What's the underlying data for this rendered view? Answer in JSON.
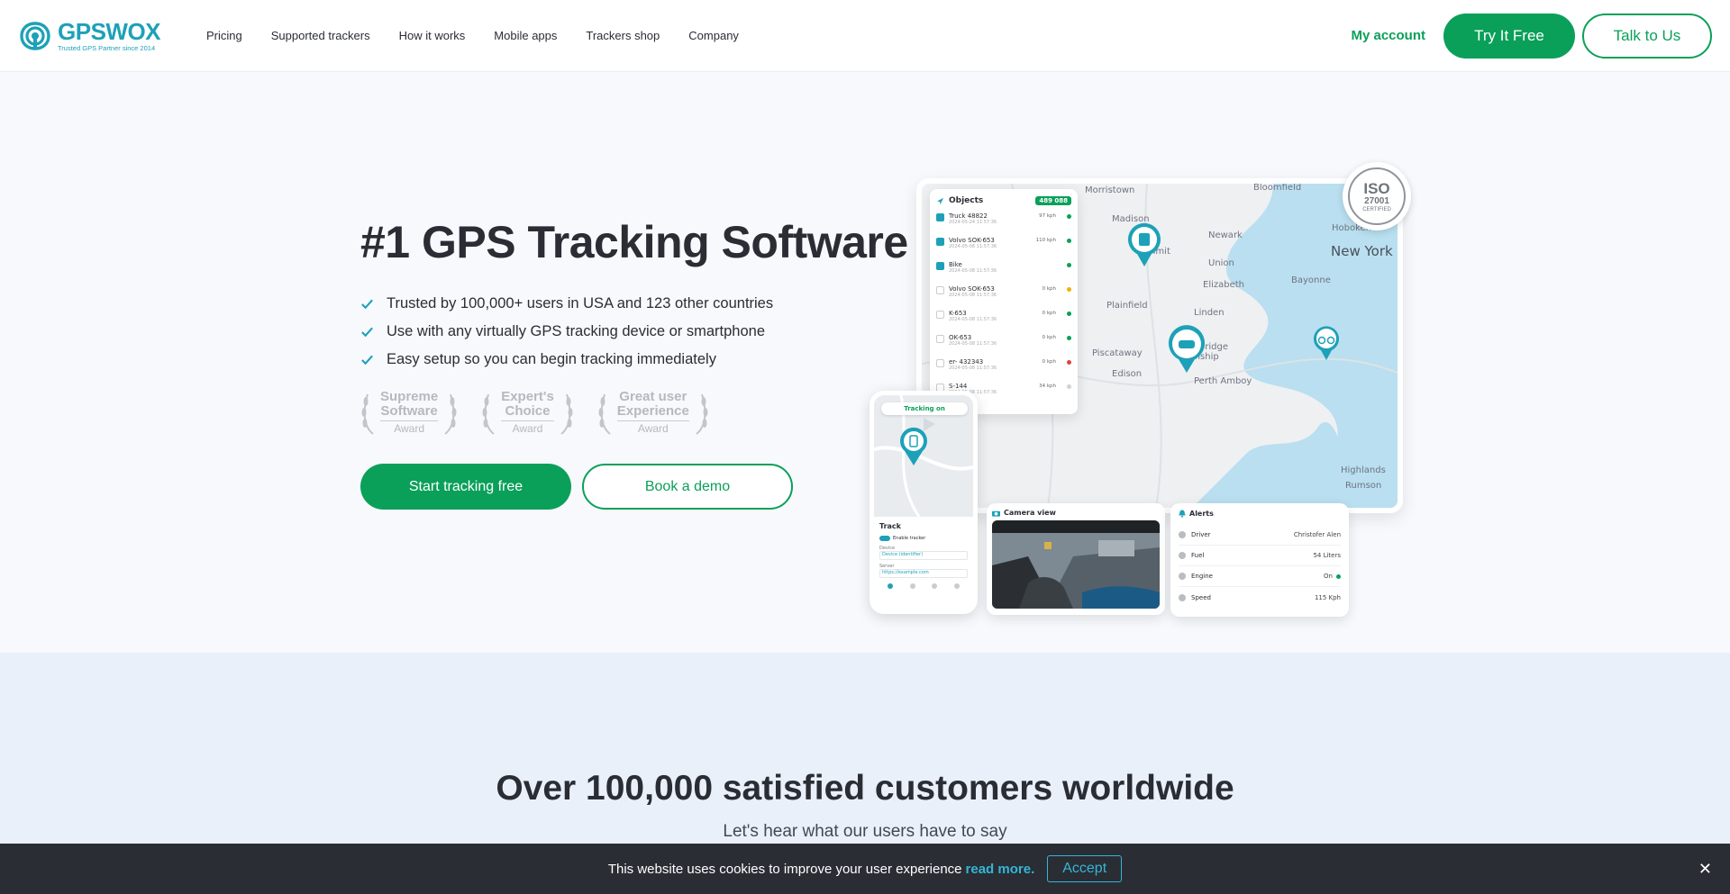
{
  "header": {
    "logo_word": "GPSWOX",
    "logo_tagline": "Trusted GPS Partner since 2014",
    "nav": [
      "Pricing",
      "Supported trackers",
      "How it works",
      "Mobile apps",
      "Trackers shop",
      "Company"
    ],
    "my_account": "My account",
    "try_free": "Try It Free",
    "talk": "Talk to Us"
  },
  "hero": {
    "title": "#1 GPS Tracking Software",
    "features": [
      "Trusted by 100,000+ users in USA and 123 other countries",
      "Use with any virtually GPS tracking device or smartphone",
      "Easy setup so you can begin tracking immediately"
    ],
    "awards": [
      {
        "line1": "Supreme",
        "line2": "Software",
        "sub": "Award"
      },
      {
        "line1": "Expert's",
        "line2": "Choice",
        "sub": "Award"
      },
      {
        "line1": "Great user",
        "line2": "Experience",
        "sub": "Award"
      }
    ],
    "start_btn": "Start tracking free",
    "demo_btn": "Book a demo"
  },
  "mockup": {
    "iso": {
      "top": "ISO",
      "num": "27001",
      "cert": "CERTIFIED"
    },
    "map_labels": [
      "Morristown",
      "Bloomfield",
      "Madison",
      "Summit",
      "Newark",
      "Hoboken",
      "New York",
      "Union",
      "Elizabeth",
      "Bayonne",
      "Plainfield",
      "Linden",
      "Piscataway",
      "Woodbridge",
      "Township",
      "Edison",
      "Perth Amboy",
      "Highlands",
      "Rumson"
    ],
    "objects": {
      "title": "Objects",
      "count": "489 088",
      "rows": [
        {
          "name": "Truck 48822",
          "time": "2024-05-24 11:57:36",
          "speed": "97 kph",
          "status": "#0aa05a",
          "checked": true
        },
        {
          "name": "Volvo SOK-653",
          "time": "2024-05-08 11:57:36",
          "speed": "110 kph",
          "status": "#0aa05a",
          "checked": true
        },
        {
          "name": "Bike",
          "time": "2024-05-08 11:57:36",
          "speed": "",
          "status": "#0aa05a",
          "checked": true
        },
        {
          "name": "Volvo SOK-653",
          "time": "2024-05-08 11:57:36",
          "speed": "0 kph",
          "status": "#f0b400",
          "checked": false
        },
        {
          "name": "K-653",
          "time": "2024-05-08 11:57:36",
          "speed": "0 kph",
          "status": "#0aa05a",
          "checked": false
        },
        {
          "name": "OK-653",
          "time": "2024-05-08 11:57:36",
          "speed": "0 kph",
          "status": "#0aa05a",
          "checked": false
        },
        {
          "name": "er- 432343",
          "time": "2024-05-08 11:57:36",
          "speed": "0 kph",
          "status": "#e0443c",
          "checked": false
        },
        {
          "name": "S-144",
          "time": "2024-05-08 11:57:36",
          "speed": "34 kph",
          "status": "#cfd3d8",
          "checked": false
        }
      ]
    },
    "phone": {
      "tracking_on": "Tracking on",
      "track_title": "Track",
      "enable_tracker": "Enable tracker",
      "device_label": "Device",
      "device_value": "Device (identifier)",
      "server_label": "Server",
      "server_value": "https://example.com"
    },
    "camera": {
      "title": "Camera view"
    },
    "alerts": {
      "title": "Alerts",
      "rows": [
        {
          "label": "Driver",
          "value": "Christofer Alen"
        },
        {
          "label": "Fuel",
          "value": "54 Liters"
        },
        {
          "label": "Engine",
          "value": "On"
        },
        {
          "label": "Speed",
          "value": "115 Kph"
        }
      ]
    }
  },
  "testimonials": {
    "title": "Over 100,000 satisfied customers worldwide",
    "subtitle": "Let's hear what our users have to say"
  },
  "cookie": {
    "text": "This website uses cookies to improve your user experience",
    "link": "read more.",
    "accept": "Accept",
    "close": "✕"
  },
  "colors": {
    "brand_green": "#0aa05a",
    "brand_teal": "#1da1b8",
    "dark": "#2a2d34",
    "cookie_link": "#34b6d6"
  }
}
